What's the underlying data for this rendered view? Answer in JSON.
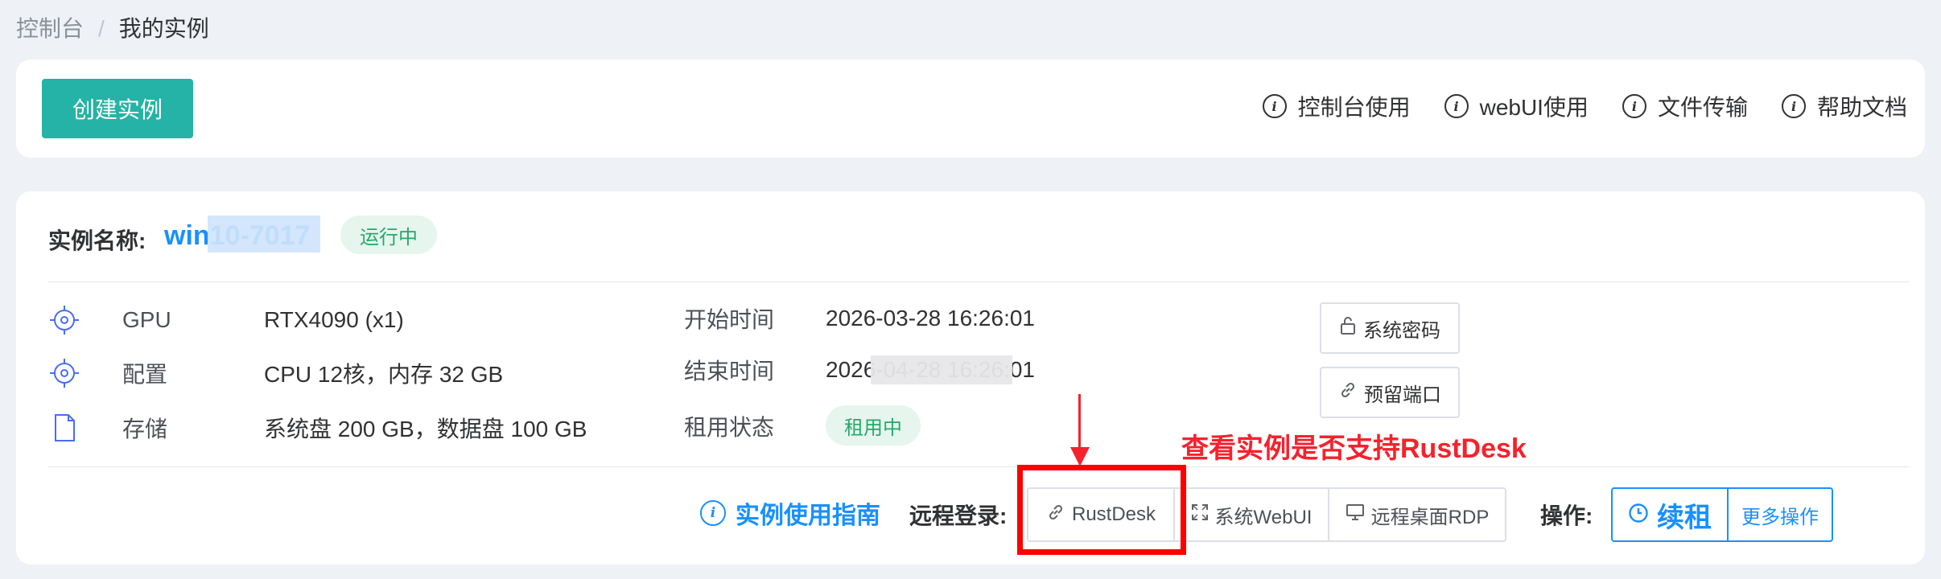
{
  "breadcrumb": {
    "root": "控制台",
    "separator": "/",
    "current": "我的实例"
  },
  "toolbar": {
    "create_label": "创建实例",
    "help_links": [
      "控制台使用",
      "webUI使用",
      "文件传输",
      "帮助文档"
    ]
  },
  "instance": {
    "name_label": "实例名称:",
    "name": "win10-7017",
    "status": "运行中",
    "specs": [
      {
        "label": "GPU",
        "value": "RTX4090 (x1)",
        "icon": "gpu-icon"
      },
      {
        "label": "配置",
        "value": "CPU 12核，内存 32 GB",
        "icon": "config-icon"
      },
      {
        "label": "存储",
        "value": "系统盘 200 GB，数据盘 100 GB",
        "icon": "storage-icon"
      }
    ],
    "times": {
      "start_label": "开始时间",
      "start_value": "2026-03-28 16:26:01",
      "end_label": "结束时间",
      "end_value": "2026-04-28 16:26:01",
      "rent_label": "租用状态",
      "rent_status": "租用中"
    },
    "side_buttons": {
      "password": "系统密码",
      "ports": "预留端口"
    }
  },
  "annotation": {
    "text": "查看实例是否支持RustDesk"
  },
  "footer": {
    "guide_label": "实例使用指南",
    "remote_label": "远程登录:",
    "remote_buttons": [
      "RustDesk",
      "系统WebUI",
      "远程桌面RDP"
    ],
    "ops_label": "操作:",
    "renew_label": "续租",
    "more_label": "更多操作"
  },
  "colors": {
    "accent": "#24b3a6",
    "link": "#1890ff",
    "success": "#27a86b",
    "annotation": "#ff0000"
  }
}
